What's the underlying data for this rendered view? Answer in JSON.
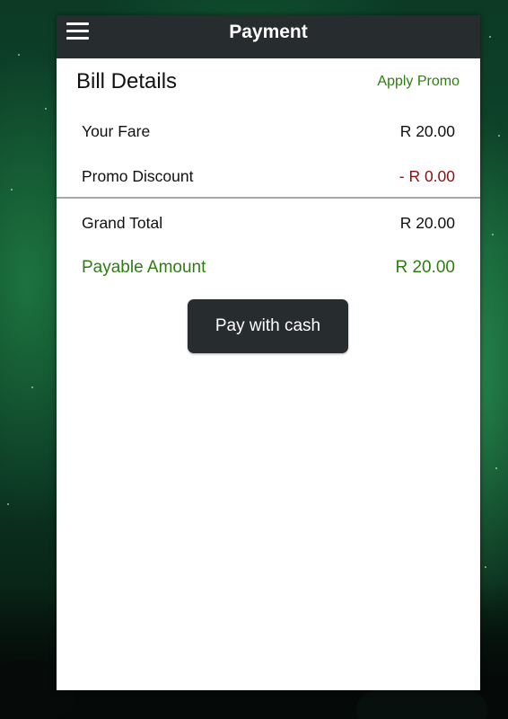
{
  "header": {
    "title": "Payment",
    "menu_icon": "hamburger-menu-icon"
  },
  "bill": {
    "title": "Bill Details",
    "apply_promo_label": "Apply Promo",
    "rows": [
      {
        "label": "Your Fare",
        "value": "R 20.00"
      },
      {
        "label": "Promo Discount",
        "value": "- R 0.00"
      },
      {
        "label": "Grand Total",
        "value": "R 20.00"
      },
      {
        "label": "Payable Amount",
        "value": "R 20.00"
      }
    ]
  },
  "actions": {
    "pay_button_label": "Pay with cash"
  },
  "colors": {
    "topbar": "#272c2f",
    "accent_green": "#2e7d12",
    "discount_red": "#8b0f0f"
  }
}
